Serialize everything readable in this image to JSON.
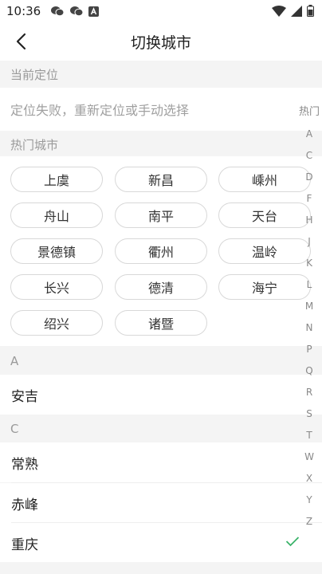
{
  "status_bar": {
    "time": "10:36"
  },
  "nav": {
    "title": "切换城市"
  },
  "current_location": {
    "header": "当前定位",
    "message": "定位失败，重新定位或手动选择"
  },
  "hot_cities": {
    "header": "热门城市",
    "items": [
      "上虞",
      "新昌",
      "嵊州",
      "舟山",
      "南平",
      "天台",
      "景德镇",
      "衢州",
      "温岭",
      "长兴",
      "德清",
      "海宁",
      "绍兴",
      "诸暨"
    ]
  },
  "sections": [
    {
      "letter": "A",
      "cities": [
        "安吉"
      ]
    },
    {
      "letter": "C",
      "cities": [
        "常熟",
        "赤峰",
        "重庆"
      ]
    }
  ],
  "selected_city": "重庆",
  "index_bar": [
    "热门",
    "A",
    "C",
    "D",
    "F",
    "H",
    "J",
    "K",
    "L",
    "M",
    "N",
    "P",
    "Q",
    "R",
    "S",
    "T",
    "W",
    "X",
    "Y",
    "Z"
  ],
  "colors": {
    "accent": "#3bb36a",
    "divider": "#eeeeee",
    "muted_text": "#9a9a9a"
  }
}
